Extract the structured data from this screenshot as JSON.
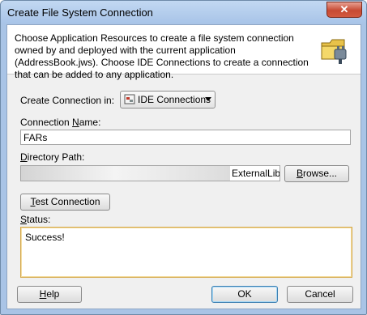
{
  "window": {
    "title": "Create File System Connection",
    "close_glyph": "✕"
  },
  "header": {
    "description": "Choose Application Resources to create a file system connection owned by and deployed with the current application (AddressBook.jws). Choose IDE Connections to create a connection that can be added to any application.",
    "icon": "folder-plug-icon"
  },
  "form": {
    "create_in_label": "Create Connection in:",
    "create_in_value": "IDE Connections",
    "name_label_pre": "Connection ",
    "name_label_mn": "N",
    "name_label_post": "ame:",
    "name_value": "FARs",
    "dir_label_mn": "D",
    "dir_label_post": "irectory Path:",
    "dir_value": "ExternalLibs",
    "browse_mn": "B",
    "browse_post": "rowse...",
    "test_mn": "T",
    "test_post": "est Connection",
    "status_mn": "S",
    "status_post": "tatus:",
    "status_value": "Success!"
  },
  "footer": {
    "help_mn": "H",
    "help_post": "elp",
    "ok": "OK",
    "cancel": "Cancel"
  }
}
